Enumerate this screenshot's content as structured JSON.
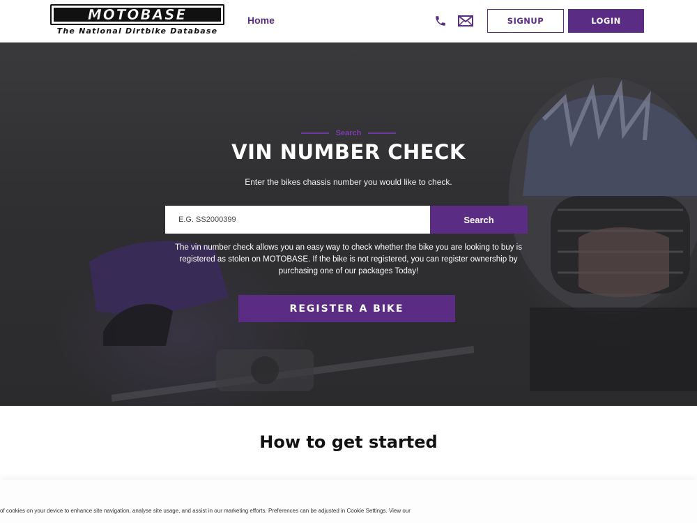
{
  "header": {
    "logo_word": "MOTOBASE",
    "logo_tagline": "The National Dirtbike Database",
    "nav_home": "Home",
    "phone_icon": "phone-icon",
    "mail_icon": "mail-icon",
    "signup_label": "SIGNUP",
    "login_label": "LOGIN"
  },
  "hero": {
    "eyebrow": "Search",
    "title": "VIN NUMBER CHECK",
    "subtitle": "Enter the bikes chassis number you would like to check.",
    "search_placeholder": "E.G. SS2000399",
    "search_button": "Search",
    "description": "The vin number check allows you an easy way to check whether the bike you are looking to buy is registered as stolen on MOTOBASE. If the bike is not registered, you can register ownership by purchasing one of our packages Today!",
    "register_button": "REGISTER A BIKE"
  },
  "section": {
    "title": "How to get started"
  },
  "cookie": {
    "text": "of cookies on your device to enhance site navigation, analyse site usage, and assist in our marketing efforts. Preferences can be adjusted in Cookie Settings. View our"
  },
  "colors": {
    "brand_purple": "#5b2c83",
    "accent_purple": "#7a3fae",
    "hero_dark": "#2f2f31"
  }
}
